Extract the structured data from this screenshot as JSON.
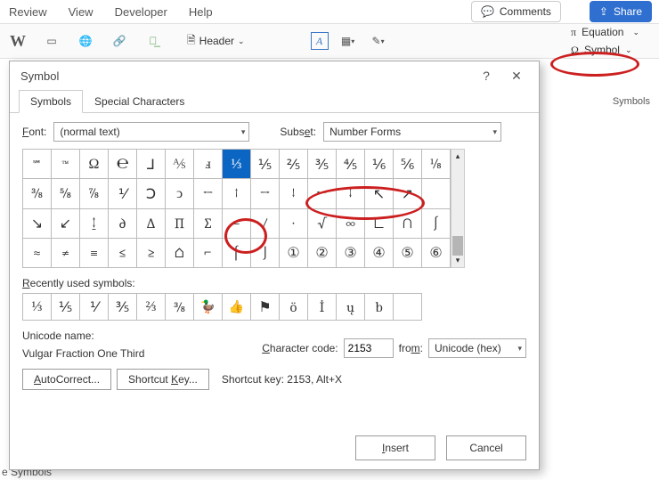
{
  "ribbon": {
    "tabs": [
      "Review",
      "View",
      "Developer",
      "Help"
    ],
    "comments": "Comments",
    "share": "Share",
    "header": "Header",
    "equation": "Equation",
    "symbol": "Symbol",
    "symbols_group": "Symbols"
  },
  "dialog": {
    "title": "Symbol",
    "tab_symbols": "Symbols",
    "tab_special": "Special Characters",
    "font_label_pre": "F",
    "font_label_post": "ont:",
    "font_value": "(normal text)",
    "subset_label_pre": "Subs",
    "subset_label_mid": "e",
    "subset_label_post": "t:",
    "subset_value": "Number Forms",
    "grid": [
      [
        "℠",
        "™",
        "Ω",
        "℮",
        "⅃",
        "⅍",
        "ⅎ",
        "⅓",
        "⅕",
        "⅖",
        "⅗",
        "⅘",
        "⅙",
        "⅚",
        "⅛"
      ],
      [
        "⅜",
        "⅝",
        "⅞",
        "⅟",
        "Ↄ",
        "ↄ",
        "←",
        "↑",
        "→",
        "↓",
        "↔",
        "↕",
        "↖",
        "↗",
        ""
      ],
      [
        "↘",
        "↙",
        "↨",
        "∂",
        "∆",
        "∏",
        "∑",
        "−",
        "∕",
        "∙",
        "√",
        "∞",
        "∟",
        "∩",
        "∫"
      ],
      [
        "≈",
        "≠",
        "≡",
        "≤",
        "≥",
        "⌂",
        "⌐",
        "⌠",
        "⌡",
        "①",
        "②",
        "③",
        "④",
        "⑤",
        "⑥"
      ]
    ],
    "grid_selected": {
      "row": 0,
      "col": 7
    },
    "recent_label_pre": "R",
    "recent_label_post": "ecently used symbols:",
    "recent": [
      "⅓",
      "⅕",
      "⅟",
      "⅗",
      "⅔",
      "⅜",
      "🦆",
      "👍",
      "⚑",
      "ö",
      "İ",
      "ų",
      "b",
      ""
    ],
    "unicode_name_label": "Unicode name:",
    "unicode_name": "Vulgar Fraction One Third",
    "char_code_label_pre": "C",
    "char_code_label_post": "haracter code:",
    "char_code": "2153",
    "from_label_pre": "fro",
    "from_label_mid": "m",
    "from_label_post": ":",
    "from_value": "Unicode (hex)",
    "autocorrect_pre": "A",
    "autocorrect_post": "utoCorrect...",
    "shortcut_btn_pre": "Shortcut ",
    "shortcut_btn_mid": "K",
    "shortcut_btn_post": "ey...",
    "shortcut_text": "Shortcut key: 2153, Alt+X",
    "insert_pre": "I",
    "insert_post": "nsert",
    "cancel": "Cancel"
  },
  "footer_left": "e Symbols"
}
